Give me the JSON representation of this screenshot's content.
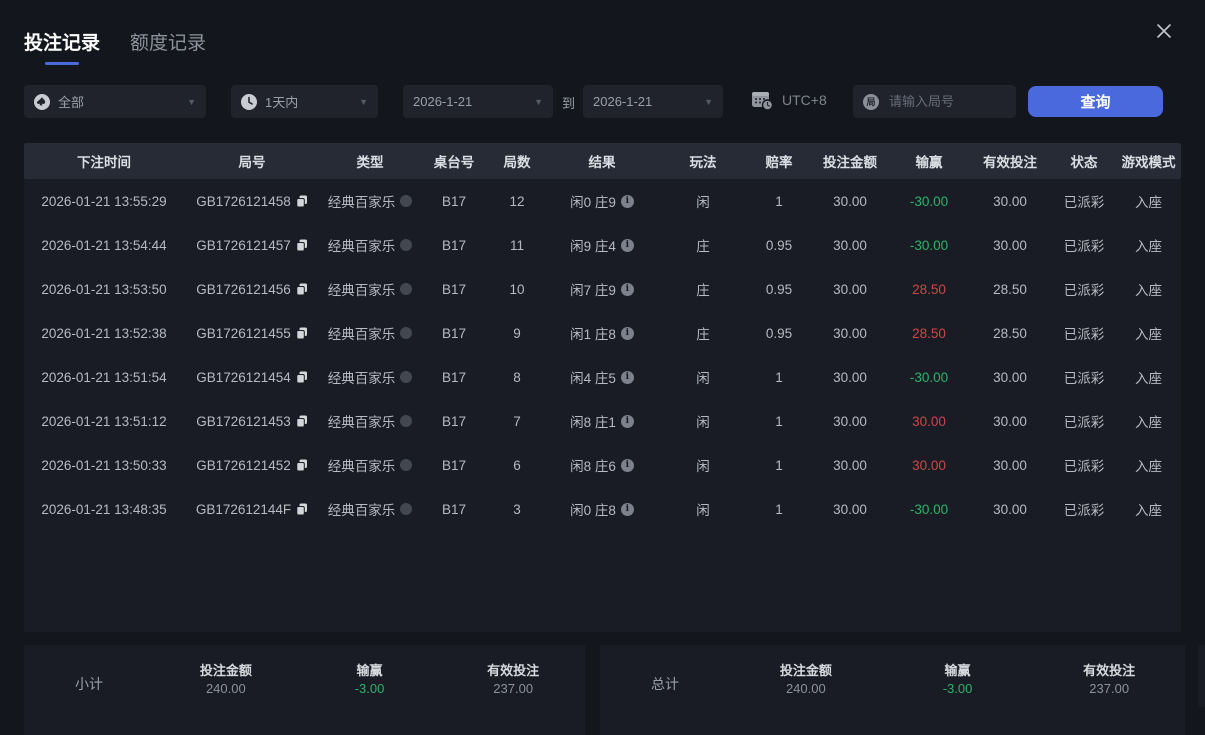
{
  "tabs": [
    {
      "label": "投注记录",
      "active": true
    },
    {
      "label": "额度记录",
      "active": false
    }
  ],
  "filters": {
    "game_type": {
      "icon": "spade-icon",
      "value": "全部"
    },
    "time_range": {
      "icon": "clock-icon",
      "value": "1天内"
    },
    "date_from": {
      "value": "2026-1-21"
    },
    "to_label": "到",
    "date_to": {
      "value": "2026-1-21"
    },
    "timezone": {
      "icon": "calendar-clock-icon",
      "label": "UTC+8"
    },
    "search": {
      "icon_char": "局",
      "placeholder": "请输入局号"
    },
    "query_button": {
      "label": "查询"
    }
  },
  "table": {
    "headers": [
      "下注时间",
      "局号",
      "类型",
      "桌台号",
      "局数",
      "结果",
      "玩法",
      "赔率",
      "投注金额",
      "输赢",
      "有效投注",
      "状态",
      "游戏模式"
    ],
    "rows": [
      {
        "time": "2026-01-21 13:55:29",
        "game_no": "GB1726121458",
        "type": "经典百家乐",
        "table_no": "B17",
        "round": "12",
        "result": "闲0 庄9",
        "play": "闲",
        "odds": "1",
        "bet": "30.00",
        "winloss": "-30.00",
        "winloss_color": "green",
        "valid": "30.00",
        "status": "已派彩",
        "mode": "入座"
      },
      {
        "time": "2026-01-21 13:54:44",
        "game_no": "GB1726121457",
        "type": "经典百家乐",
        "table_no": "B17",
        "round": "11",
        "result": "闲9 庄4",
        "play": "庄",
        "odds": "0.95",
        "bet": "30.00",
        "winloss": "-30.00",
        "winloss_color": "green",
        "valid": "30.00",
        "status": "已派彩",
        "mode": "入座"
      },
      {
        "time": "2026-01-21 13:53:50",
        "game_no": "GB1726121456",
        "type": "经典百家乐",
        "table_no": "B17",
        "round": "10",
        "result": "闲7 庄9",
        "play": "庄",
        "odds": "0.95",
        "bet": "30.00",
        "winloss": "28.50",
        "winloss_color": "red",
        "valid": "28.50",
        "status": "已派彩",
        "mode": "入座"
      },
      {
        "time": "2026-01-21 13:52:38",
        "game_no": "GB1726121455",
        "type": "经典百家乐",
        "table_no": "B17",
        "round": "9",
        "result": "闲1 庄8",
        "play": "庄",
        "odds": "0.95",
        "bet": "30.00",
        "winloss": "28.50",
        "winloss_color": "red",
        "valid": "28.50",
        "status": "已派彩",
        "mode": "入座"
      },
      {
        "time": "2026-01-21 13:51:54",
        "game_no": "GB1726121454",
        "type": "经典百家乐",
        "table_no": "B17",
        "round": "8",
        "result": "闲4 庄5",
        "play": "闲",
        "odds": "1",
        "bet": "30.00",
        "winloss": "-30.00",
        "winloss_color": "green",
        "valid": "30.00",
        "status": "已派彩",
        "mode": "入座"
      },
      {
        "time": "2026-01-21 13:51:12",
        "game_no": "GB1726121453",
        "type": "经典百家乐",
        "table_no": "B17",
        "round": "7",
        "result": "闲8 庄1",
        "play": "闲",
        "odds": "1",
        "bet": "30.00",
        "winloss": "30.00",
        "winloss_color": "red",
        "valid": "30.00",
        "status": "已派彩",
        "mode": "入座"
      },
      {
        "time": "2026-01-21 13:50:33",
        "game_no": "GB1726121452",
        "type": "经典百家乐",
        "table_no": "B17",
        "round": "6",
        "result": "闲8 庄6",
        "play": "闲",
        "odds": "1",
        "bet": "30.00",
        "winloss": "30.00",
        "winloss_color": "red",
        "valid": "30.00",
        "status": "已派彩",
        "mode": "入座"
      },
      {
        "time": "2026-01-21 13:48:35",
        "game_no": "GB172612144F",
        "type": "经典百家乐",
        "table_no": "B17",
        "round": "3",
        "result": "闲0 庄8",
        "play": "闲",
        "odds": "1",
        "bet": "30.00",
        "winloss": "-30.00",
        "winloss_color": "green",
        "valid": "30.00",
        "status": "已派彩",
        "mode": "入座"
      }
    ]
  },
  "summary": {
    "subtotal": {
      "label": "小计",
      "items": [
        {
          "label": "投注金额",
          "value": "240.00",
          "color": "muted"
        },
        {
          "label": "输赢",
          "value": "-3.00",
          "color": "green"
        },
        {
          "label": "有效投注",
          "value": "237.00",
          "color": "muted"
        }
      ]
    },
    "total": {
      "label": "总计",
      "items": [
        {
          "label": "投注金额",
          "value": "240.00",
          "color": "muted"
        },
        {
          "label": "输赢",
          "value": "-3.00",
          "color": "green"
        },
        {
          "label": "有效投注",
          "value": "237.00",
          "color": "muted"
        }
      ]
    }
  },
  "colors": {
    "accent_blue": "#4a69dd",
    "win_red": "#cd4747",
    "loss_green": "#2db36a"
  }
}
